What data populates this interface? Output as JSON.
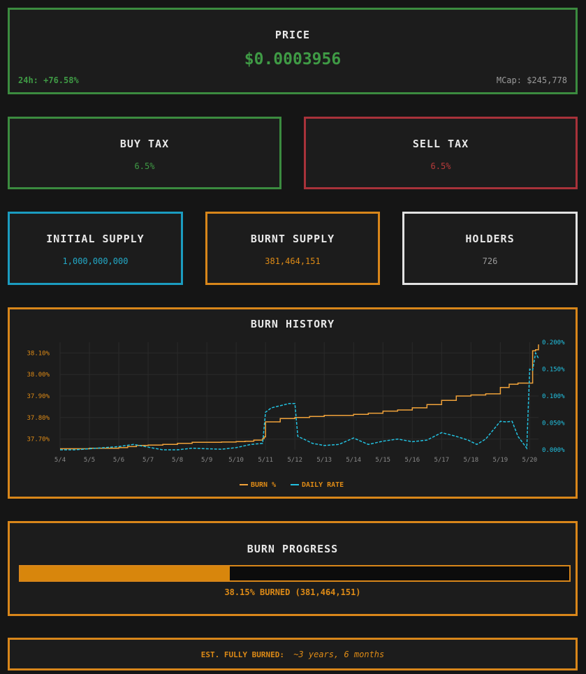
{
  "price": {
    "title": "PRICE",
    "value": "$0.0003956",
    "change": "24h: +76.58%",
    "mcap": "MCap: $245,778"
  },
  "buy_tax": {
    "title": "BUY TAX",
    "value": "6.5%"
  },
  "sell_tax": {
    "title": "SELL TAX",
    "value": "6.5%"
  },
  "initial_supply": {
    "title": "INITIAL SUPPLY",
    "value": "1,000,000,000"
  },
  "burnt_supply": {
    "title": "BURNT SUPPLY",
    "value": "381,464,151"
  },
  "holders": {
    "title": "HOLDERS",
    "value": "726"
  },
  "burn_history": {
    "title": "BURN HISTORY",
    "legend_burn": "BURN %",
    "legend_rate": "DAILY RATE"
  },
  "burn_progress": {
    "title": "BURN PROGRESS",
    "percent": 38.15,
    "label": "38.15% BURNED (381,464,151)"
  },
  "estimate": {
    "label": "EST. FULLY BURNED:",
    "value": "~3 years, 6 months"
  },
  "colors": {
    "green": "#3f9a45",
    "red": "#b63a3a",
    "cyan": "#23a9c7",
    "orange": "#dd8a16",
    "burn_line": "#f0a23a",
    "rate_line": "#22c1e0"
  },
  "chart_data": {
    "type": "line",
    "title": "BURN HISTORY",
    "x_tick_labels": [
      "5/4",
      "5/5",
      "5/6",
      "5/7",
      "5/8",
      "5/9",
      "5/10",
      "5/11",
      "5/12",
      "5/13",
      "5/14",
      "5/15",
      "5/16",
      "5/17",
      "5/18",
      "5/19",
      "5/20"
    ],
    "left_axis": {
      "tick_labels": [
        "37.70%",
        "37.80%",
        "37.90%",
        "38.00%",
        "38.10%"
      ],
      "ylim": [
        37.65,
        38.15
      ]
    },
    "right_axis": {
      "tick_labels": [
        "0.000%",
        "0.050%",
        "0.100%",
        "0.150%",
        "0.200%"
      ],
      "ylim": [
        0,
        0.2
      ]
    },
    "grid": true,
    "legend": "bottom",
    "series": [
      {
        "name": "BURN %",
        "axis": "left",
        "style": "solid",
        "x": [
          0,
          0.5,
          1,
          1.5,
          2,
          2.3,
          2.6,
          3,
          3.5,
          4,
          4.5,
          5,
          5.5,
          6,
          6.3,
          6.6,
          6.9,
          6.95,
          7,
          7.5,
          8,
          8.5,
          9,
          9.5,
          10,
          10.5,
          11,
          11.5,
          12,
          12.5,
          13,
          13.5,
          14,
          14.5,
          15,
          15.3,
          15.6,
          15.9,
          16.0,
          16.1,
          16.2,
          16.3
        ],
        "y": [
          37.655,
          37.655,
          37.657,
          37.657,
          37.66,
          37.665,
          37.67,
          37.672,
          37.675,
          37.68,
          37.685,
          37.685,
          37.686,
          37.688,
          37.69,
          37.695,
          37.702,
          37.71,
          37.78,
          37.795,
          37.8,
          37.805,
          37.81,
          37.81,
          37.815,
          37.82,
          37.83,
          37.835,
          37.845,
          37.86,
          37.88,
          37.9,
          37.905,
          37.91,
          37.94,
          37.955,
          37.96,
          37.96,
          37.96,
          38.11,
          38.115,
          38.14
        ]
      },
      {
        "name": "DAILY RATE",
        "axis": "right",
        "style": "dashed",
        "x": [
          0,
          0.5,
          1,
          1.5,
          2,
          2.5,
          3,
          3.5,
          4,
          4.5,
          5,
          5.5,
          6,
          6.5,
          6.9,
          7.0,
          7.2,
          7.5,
          7.8,
          8.0,
          8.1,
          8.3,
          8.6,
          9,
          9.5,
          10,
          10.5,
          11,
          11.5,
          12,
          12.5,
          13,
          13.5,
          13.9,
          14.2,
          14.5,
          15,
          15.2,
          15.4,
          15.6,
          15.9,
          16.0,
          16.1,
          16.2,
          16.3
        ],
        "y": [
          0.0,
          0.0,
          0.002,
          0.004,
          0.006,
          0.01,
          0.005,
          0.0,
          0.0,
          0.003,
          0.002,
          0.001,
          0.004,
          0.01,
          0.012,
          0.07,
          0.078,
          0.082,
          0.086,
          0.086,
          0.025,
          0.02,
          0.012,
          0.008,
          0.01,
          0.022,
          0.01,
          0.016,
          0.02,
          0.015,
          0.018,
          0.032,
          0.025,
          0.018,
          0.01,
          0.02,
          0.053,
          0.052,
          0.053,
          0.025,
          0.003,
          0.15,
          0.148,
          0.18,
          0.17
        ]
      }
    ]
  }
}
